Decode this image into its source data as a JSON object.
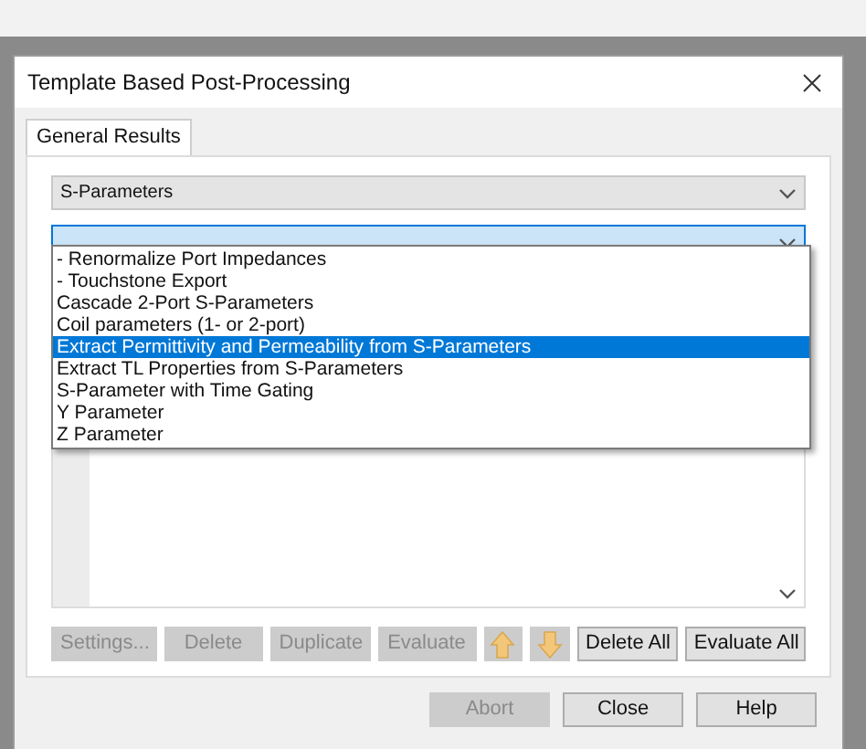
{
  "window": {
    "title": "Template Based Post-Processing"
  },
  "tabs": [
    {
      "label": "General Results",
      "selected": true
    }
  ],
  "category_select": {
    "value": "S-Parameters"
  },
  "template_select": {
    "expanded": true,
    "options": [
      {
        "label": "- Renormalize Port Impedances",
        "selected": false
      },
      {
        "label": "- Touchstone Export",
        "selected": false
      },
      {
        "label": "Cascade 2-Port S-Parameters",
        "selected": false
      },
      {
        "label": "Coil parameters (1- or 2-port)",
        "selected": false
      },
      {
        "label": "Extract Permittivity and Permeability from S-Parameters",
        "selected": true
      },
      {
        "label": "Extract TL Properties from S-Parameters",
        "selected": false
      },
      {
        "label": "S-Parameter with Time Gating",
        "selected": false
      },
      {
        "label": "Y Parameter",
        "selected": false
      },
      {
        "label": "Z Parameter",
        "selected": false
      }
    ]
  },
  "list_buttons": [
    {
      "kind": "text",
      "label": "Settings...",
      "disabled": true
    },
    {
      "kind": "text",
      "label": "Delete",
      "disabled": true
    },
    {
      "kind": "text",
      "label": "Duplicate",
      "disabled": true
    },
    {
      "kind": "text",
      "label": "Evaluate",
      "disabled": true
    },
    {
      "kind": "up",
      "disabled": true
    },
    {
      "kind": "down",
      "disabled": true
    },
    {
      "kind": "text",
      "label": "Delete All",
      "disabled": false
    },
    {
      "kind": "text",
      "label": "Evaluate All",
      "disabled": false
    }
  ],
  "dialog_buttons": [
    {
      "label": "Abort",
      "disabled": true
    },
    {
      "label": "Close",
      "disabled": false
    },
    {
      "label": "Help",
      "disabled": false
    }
  ]
}
